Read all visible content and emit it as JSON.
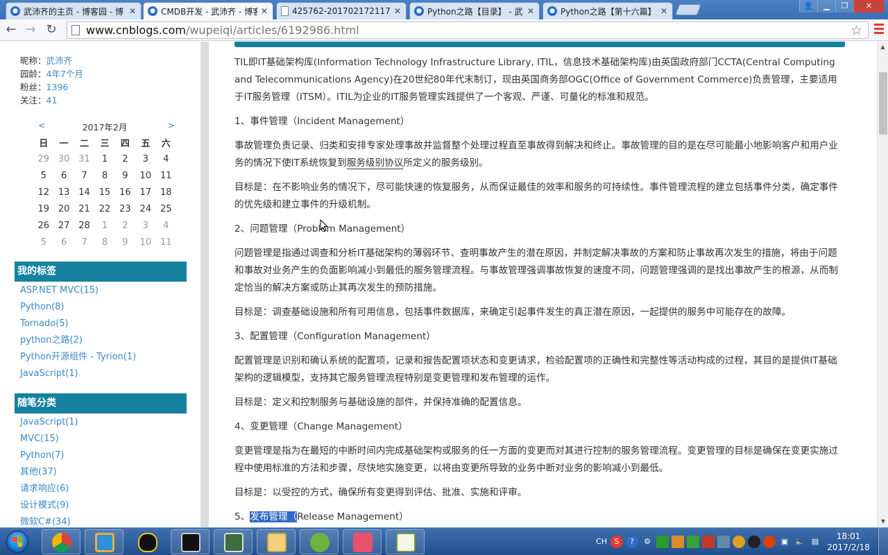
{
  "browser": {
    "tabs": [
      {
        "title": "武沛齐的主页 - 博客园 - 博",
        "icon": "cnblogs-icon",
        "active": false
      },
      {
        "title": "CMDB开发 - 武沛齐 - 博客",
        "icon": "cnblogs-icon",
        "active": true
      },
      {
        "title": "425762-20170217211742",
        "icon": "document-icon",
        "active": false
      },
      {
        "title": "Python之路【目录】 - 武",
        "icon": "cnblogs-icon",
        "active": false
      },
      {
        "title": "Python之路【第十六篇】",
        "icon": "cnblogs-icon",
        "active": false
      }
    ],
    "url_host": "www.cnblogs.com",
    "url_path": "/wupeiqi/articles/6192986.html"
  },
  "profile": {
    "nickname_label": "昵称：",
    "nickname": "武沛齐",
    "age_label": "园龄：",
    "age": "4年7个月",
    "fans_label": "粉丝：",
    "fans": "1396",
    "follow_label": "关注：",
    "follow": "41"
  },
  "calendar": {
    "prev": "<",
    "next": ">",
    "month": "2017年2月",
    "weekdays": [
      "日",
      "一",
      "二",
      "三",
      "四",
      "五",
      "六"
    ],
    "weeks": [
      [
        "29",
        "30",
        "31",
        "1",
        "2",
        "3",
        "4"
      ],
      [
        "5",
        "6",
        "7",
        "8",
        "9",
        "10",
        "11"
      ],
      [
        "12",
        "13",
        "14",
        "15",
        "16",
        "17",
        "18"
      ],
      [
        "19",
        "20",
        "21",
        "22",
        "23",
        "24",
        "25"
      ],
      [
        "26",
        "27",
        "28",
        "1",
        "2",
        "3",
        "4"
      ],
      [
        "5",
        "6",
        "7",
        "8",
        "9",
        "10",
        "11"
      ]
    ]
  },
  "tags": {
    "title": "我的标签",
    "items": [
      {
        "name": "ASP.NET MVC",
        "count": "(15)"
      },
      {
        "name": "Python",
        "count": "(8)"
      },
      {
        "name": "Tornado",
        "count": "(5)"
      },
      {
        "name": "python之路",
        "count": "(2)"
      },
      {
        "name": "Python开源组件 - Tyrion",
        "count": "(1)"
      },
      {
        "name": "JavaScript",
        "count": "(1)"
      }
    ]
  },
  "categories": {
    "title": "随笔分类",
    "items": [
      "JavaScript(1)",
      "MVC(15)",
      "Python(7)",
      "其他(37)",
      "请求响应(6)",
      "设计模式(9)",
      "微软C#(34)"
    ]
  },
  "article": {
    "intro": "TIL即IT基础架构库(Information Technology Infrastructure Library, ITIL，信息技术基础架构库)由英国政府部门CCTA(Central Computing and Telecommunications Agency)在20世纪80年代末制订，现由英国商务部OGC(Office of Government Commerce)负责管理，主要适用于IT服务管理（ITSM）。ITIL为企业的IT服务管理实践提供了一个客观、严谨、可量化的标准和规范。",
    "h1": "1、事件管理（Incident Management）",
    "p1a": "事故管理负责记录、归类和安排专家处理事故并监督整个处理过程直至事故得到解决和终止。事故管理的目的是在尽可能最小地影响客户和用户业务的情况下使IT系统恢复到",
    "p1link": "服务级别协议",
    "p1b": "所定义的服务级别。",
    "p1goal": "目标是：在不影响业务的情况下，尽可能快速的恢复服务，从而保证最佳的效率和服务的可持续性。事件管理流程的建立包括事件分类，确定事件的优先级和建立事件的升级机制。",
    "h2": "2、问题管理（Problem Management）",
    "p2": "问题管理是指通过调查和分析IT基础架构的薄弱环节、查明事故产生的潜在原因，并制定解决事故的方案和防止事故再次发生的措施，将由于问题和事故对业务产生的负面影响减小到最低的服务管理流程。与事故管理强调事故恢复的速度不同，问题管理强调的是找出事故产生的根源，从而制定恰当的解决方案或防止其再次发生的预防措施。",
    "p2goal": "目标是：调查基础设施和所有可用信息，包括事件数据库，来确定引起事件发生的真正潜在原因，一起提供的服务中可能存在的故障。",
    "h3": "3、配置管理（Configuration Management）",
    "p3": "配置管理是识别和确认系统的配置项，记录和报告配置项状态和变更请求，检验配置项的正确性和完整性等活动构成的过程，其目的是提供IT基础架构的逻辑模型，支持其它服务管理流程特别是变更管理和发布管理的运作。",
    "p3goal": "目标是：定义和控制服务与基础设施的部件，并保持准确的配置信息。",
    "h4": "4、变更管理（Change Management）",
    "p4": "变更管理是指为在最短的中断时间内完成基础架构或服务的任一方面的变更而对其进行控制的服务管理流程。变更管理的目标是确保在变更实施过程中使用标准的方法和步骤，尽快地实施变更，以将由变更所导致的业务中断对业务的影响减小到最低。",
    "p4goal": "目标是：以受控的方式，确保所有变更得到评估、批准、实施和评审。",
    "h5_prefix": "5、",
    "h5_selected": "发布管理（",
    "h5_rest": "Release Management）"
  },
  "taskbar": {
    "apps": [
      "chrome-icon",
      "window-icon",
      "qq-icon",
      "terminal-icon",
      "monitor-icon",
      "folder-icon",
      "editor-icon",
      "heart-app-icon",
      "notepad-icon"
    ],
    "tray_lang": "CH",
    "time": "18:01",
    "date": "2017/2/18"
  },
  "colors": {
    "accent": "#15819f",
    "link": "#3b88c4",
    "selection": "#3169c6"
  }
}
